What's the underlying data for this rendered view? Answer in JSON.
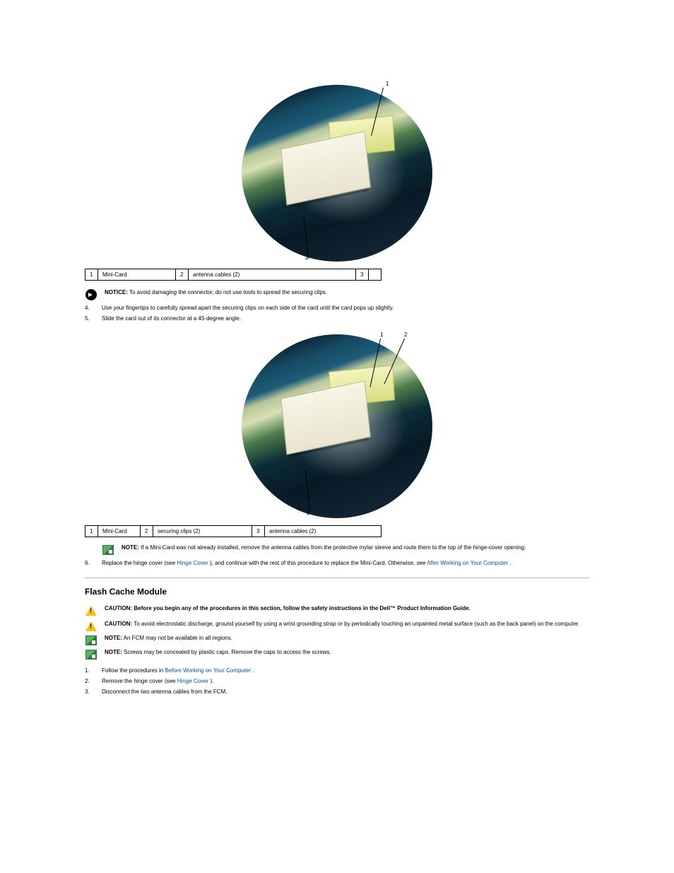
{
  "figure1": {
    "callouts": {
      "c1": {
        "num": "1",
        "label": "Mini-Card"
      },
      "c2": {
        "num": "2",
        "label": "antenna cables (2)"
      },
      "c3": {
        "num": "3"
      }
    }
  },
  "notices": {
    "notice1_label": "NOTICE:",
    "notice1_text": "To avoid damaging the connector, do not use tools to spread the securing clips.",
    "note1_label": "NOTE:",
    "note1_text": "If a Mini-Card was not already installed, remove the antenna cables from the protective mylar sleeve and route them to the top of the hinge-cover opening.",
    "caution1_label": "CAUTION:",
    "caution1_text": "Before you begin any of the procedures in this section, follow the safety instructions in the Dell™ Product Information Guide.",
    "caution2_label": "CAUTION:",
    "caution2_text": "To avoid electrostatic discharge, ground yourself by using a wrist grounding strap or by periodically touching an unpainted metal surface (such as the back panel) on the computer.",
    "note2_label": "NOTE:",
    "note2_text": "An FCM may not be available in all regions.",
    "note3_label": "NOTE:",
    "note3_text": "Screws may be concealed by plastic caps. Remove the caps to access the screws."
  },
  "steps_a": {
    "s4": {
      "num": "4.",
      "text": "Use your fingertips to carefully spread apart the securing clips on each side of the card until the card pops up slightly."
    },
    "s5": {
      "num": "5.",
      "text": "Slide the card out of its connector at a 45-degree angle."
    }
  },
  "figure2": {
    "callouts": {
      "c1": {
        "num": "1",
        "label": "Mini-Card"
      },
      "c2": {
        "num": "2",
        "label": "securing clips (2)"
      },
      "c3": {
        "num": "3",
        "label": "antenna cables (2)"
      }
    }
  },
  "steps_b": {
    "s6": {
      "num": "6.",
      "prefix": "Replace the hinge cover (see ",
      "link": "Hinge Cover",
      "suffix": "), and continue with the rest of this procedure to replace the Mini-Card. Otherwise, see ",
      "link2": "After Working on Your Computer",
      "suffix2": "."
    }
  },
  "section2": {
    "title": "Flash Cache Module"
  },
  "steps_c": {
    "s1": {
      "num": "1.",
      "prefix": "Follow the procedures in ",
      "link": "Before Working on Your Computer",
      "suffix": "."
    },
    "s2": {
      "num": "2.",
      "prefix": "Remove the hinge cover (see ",
      "link": "Hinge Cover",
      "suffix": ")."
    },
    "s3": {
      "num": "3.",
      "text": "Disconnect the two antenna cables from the FCM."
    }
  }
}
